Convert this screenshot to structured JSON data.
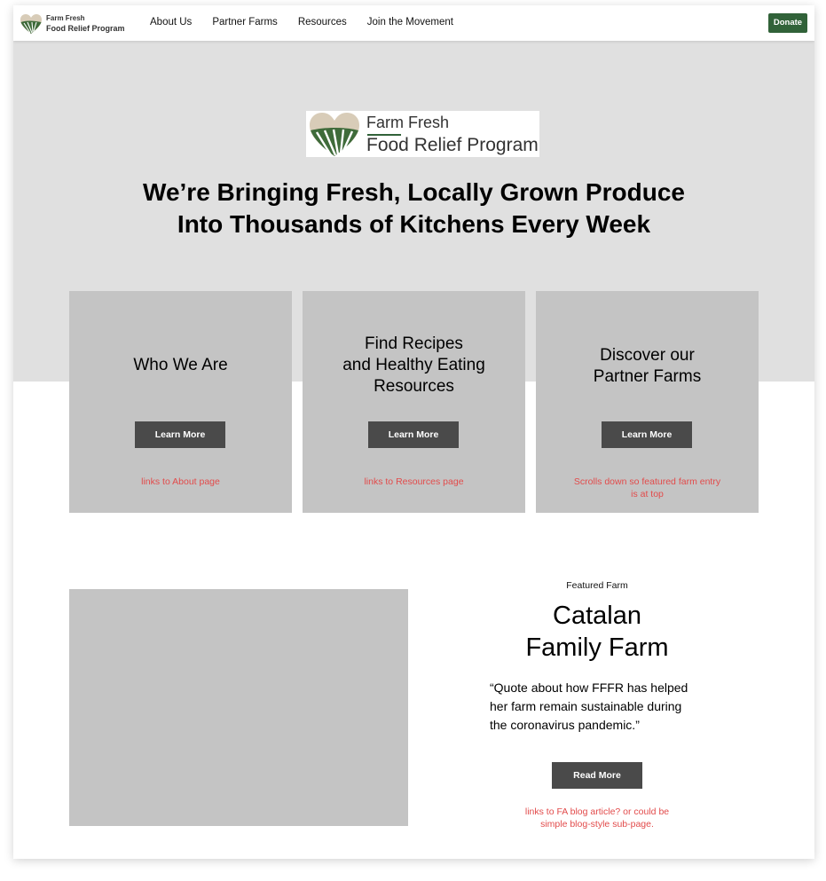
{
  "nav": {
    "logo_line1": "Farm Fresh",
    "logo_line2": "Food Relief Program",
    "links": [
      "About Us",
      "Partner Farms",
      "Resources",
      "Join the Movement"
    ],
    "donate_label": "Donate"
  },
  "hero": {
    "logo_line1": "Farm Fresh",
    "logo_line2": "Food Relief Program",
    "headline_line1": "We’re Bringing Fresh, Locally Grown Produce",
    "headline_line2": "Into Thousands of Kitchens Every Week"
  },
  "cards": [
    {
      "title_lines": [
        "Who We Are"
      ],
      "button": "Learn More",
      "note_lines": [
        "links to About page"
      ]
    },
    {
      "title_lines": [
        "Find Recipes",
        "and Healthy Eating",
        "Resources"
      ],
      "button": "Learn More",
      "note_lines": [
        "links to Resources page"
      ]
    },
    {
      "title_lines": [
        "Discover our",
        "Partner Farms"
      ],
      "button": "Learn More",
      "note_lines": [
        "Scrolls down so featured farm entry",
        "is at top"
      ]
    }
  ],
  "featured": {
    "label": "Featured Farm",
    "title_line1": "Catalan",
    "title_line2": "Family Farm",
    "quote_lines": [
      "“Quote about how FFFR has helped",
      "her farm remain sustainable during",
      "the coronavirus pandemic.”"
    ],
    "button": "Read More",
    "note_lines": [
      "links to FA blog article? or could be",
      "simple blog-style sub-page."
    ]
  },
  "colors": {
    "brand_green": "#316239",
    "note_red": "#e24b4b",
    "placeholder_gray": "#c4c4c4",
    "hero_gray": "#e0e0e0",
    "button_dark": "#4a4a4a"
  },
  "icons": {
    "logo": "heart-farm-fields-logo"
  }
}
